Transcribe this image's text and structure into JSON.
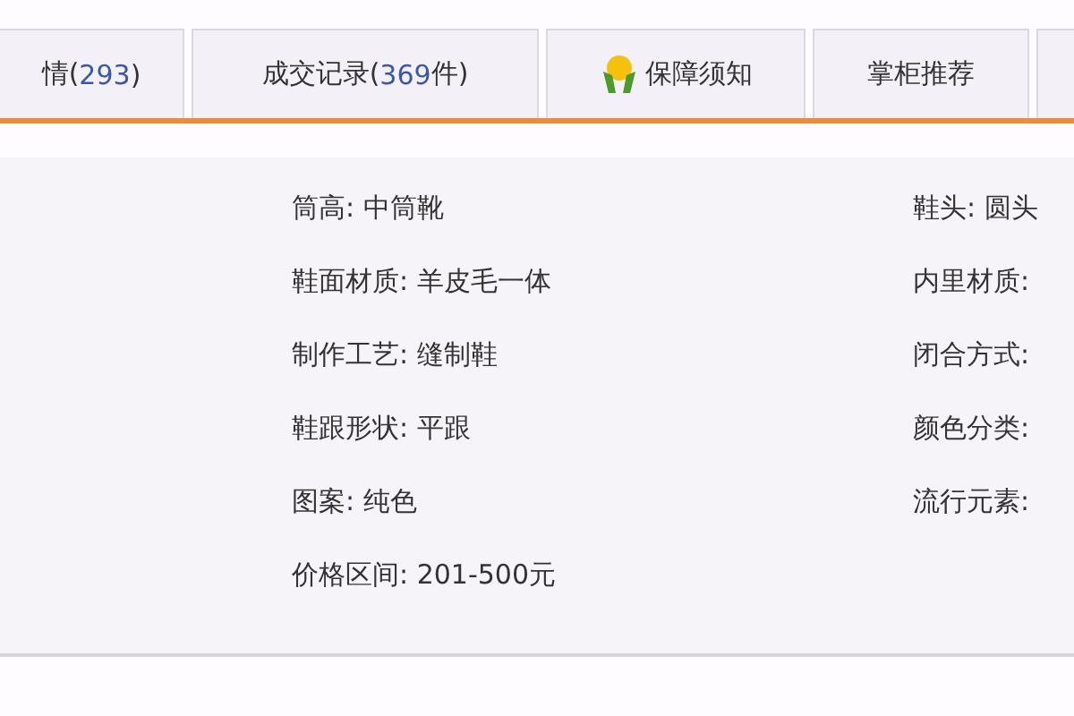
{
  "tabs": [
    {
      "kind": "count",
      "prefix": "情(",
      "count": "293",
      "suffix": ")"
    },
    {
      "kind": "count",
      "prefix": "成交记录(",
      "count": "369",
      "suffix": "件)"
    },
    {
      "kind": "icon",
      "label": "保障须知"
    },
    {
      "kind": "plain",
      "label": "掌柜推荐"
    },
    {
      "kind": "blank"
    }
  ],
  "attributes": {
    "column_1": [
      "筒高: 中筒靴",
      "鞋面材质: 羊皮毛一体",
      "制作工艺: 缝制鞋",
      "鞋跟形状: 平跟",
      "图案: 纯色",
      "价格区间: 201-500元"
    ],
    "column_2": [
      "鞋头: 圆头",
      "内里材质:",
      "闭合方式:",
      "颜色分类:",
      "流行元素:"
    ]
  }
}
